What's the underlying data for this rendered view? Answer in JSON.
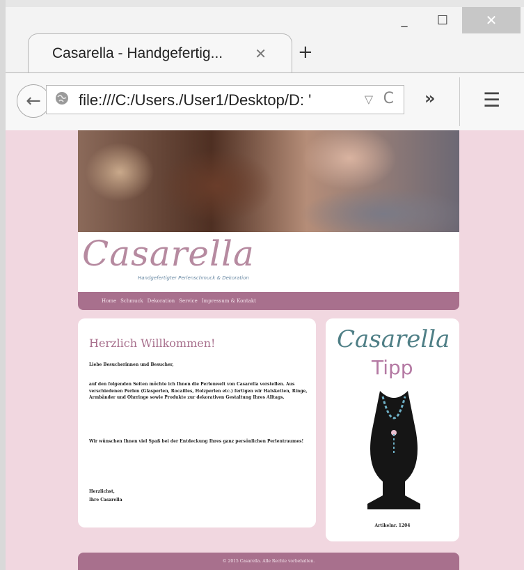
{
  "browser": {
    "tab_title": "Casarella - Handgefertig...",
    "tab_close": "✕",
    "new_tab": "+",
    "url": "file:///C:/Users./User1/Desktop/D: '",
    "back": "←",
    "reload": "C",
    "url_dropdown": "▽",
    "overflow": "»",
    "menu": "☰",
    "window": {
      "minimize": "_",
      "maximize": "☐",
      "close": "✕"
    }
  },
  "site": {
    "logo": "Casarella",
    "tagline": "Handgefertigter Perlenschmuck & Dekoration",
    "nav": [
      "Home",
      "Schmuck",
      "Dekoration",
      "Service",
      "Impressum & Kontakt"
    ],
    "welcome_heading": "Herzlich Willkommen!",
    "greeting": "Liebe Besucherinnen und Besucher,",
    "intro": "auf den folgenden Seiten möchte ich Ihnen die Perlenwelt von Casarella vorstellen. Aus verschiedenen Perlen (Glasperlen, Rocailles, Holzperlen etc.) fertigen wir Halsketten, Ringe, Armbänder und Ohrringe sowie Produkte zur dekorativen Gestaltung Ihres Alltags.",
    "wish": "Wir wünschen Ihnen viel Spaß bei der Entdeckung Ihres ganz persönlichen Perlentraumes!",
    "sign_off_1": "Herzlichst,",
    "sign_off_2": "Ihre Casarella",
    "side_logo": "Casarella",
    "side_tipp": "Tipp",
    "article": "Artikelnr. 1204",
    "footer": "© 2015 Casarella. Alle Rechte vorbehalten."
  },
  "colors": {
    "accent": "#a8708d",
    "background": "#f1d7e0",
    "side_logo": "#4f7f86"
  }
}
